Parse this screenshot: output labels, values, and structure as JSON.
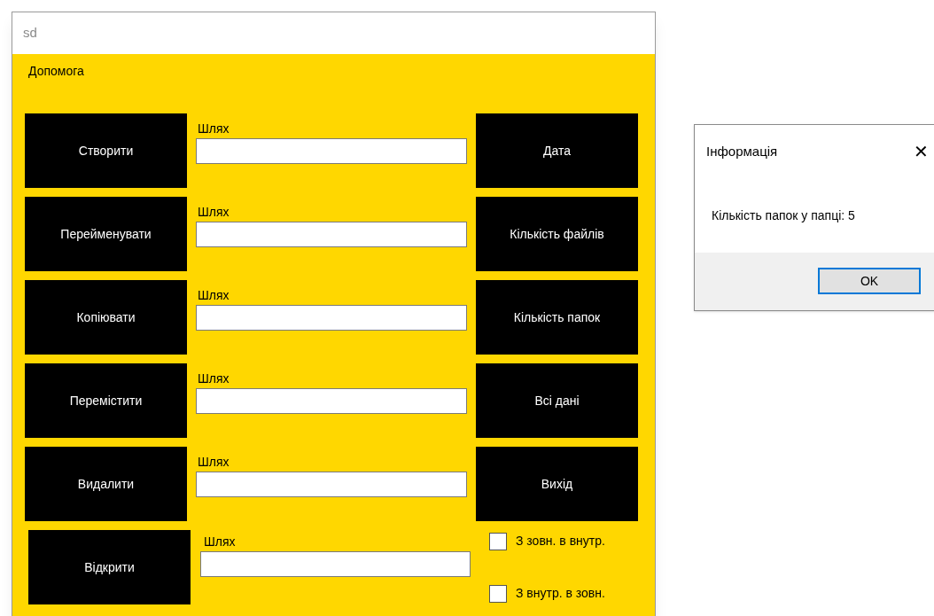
{
  "window": {
    "title": "sd"
  },
  "menu": [
    "Допомога"
  ],
  "rows": [
    {
      "button": "Створити",
      "path_label": "Шлях",
      "right_button": "Дата"
    },
    {
      "button": "Перейменувати",
      "path_label": "Шлях",
      "right_button": "Кількість файлів"
    },
    {
      "button": "Копіювати",
      "path_label": "Шлях",
      "right_button": "Кількість папок"
    },
    {
      "button": "Перемістити",
      "path_label": "Шлях",
      "right_button": "Всі дані"
    },
    {
      "button": "Видалити",
      "path_label": "Шлях",
      "right_button": "Вихід"
    }
  ],
  "last_row": {
    "button": "Відкрити",
    "path_label": "Шлях"
  },
  "checkboxes": [
    {
      "label": "З зовн. в внутр.",
      "checked": false
    },
    {
      "label": "З внутр. в зовн.",
      "checked": false
    }
  ],
  "dialog": {
    "title": "Інформація",
    "close": "✕",
    "message": "Кількість папок у папці: 5",
    "button": "OK"
  }
}
